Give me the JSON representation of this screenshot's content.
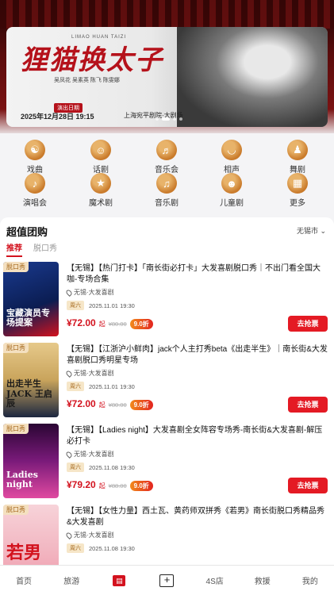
{
  "banner": {
    "title": "狸猫换太子",
    "title_en": "LIMAO HUAN TAIZI",
    "cast": "吴凤花 吴素英 陈飞 陈雯娜",
    "tag": "演出日期",
    "date": "2025年12月28日 19:15",
    "venue": "上海宛平剧院·大剧场"
  },
  "categories": [
    {
      "label": "戏曲",
      "icon": "opera-mask-icon"
    },
    {
      "label": "话剧",
      "icon": "drama-mask-icon"
    },
    {
      "label": "音乐会",
      "icon": "microphone-icon"
    },
    {
      "label": "相声",
      "icon": "lips-icon"
    },
    {
      "label": "舞剧",
      "icon": "dancer-icon"
    },
    {
      "label": "演唱会",
      "icon": "guitar-icon"
    },
    {
      "label": "魔术剧",
      "icon": "star-icon"
    },
    {
      "label": "音乐剧",
      "icon": "music-note-icon"
    },
    {
      "label": "儿童剧",
      "icon": "toy-icon"
    },
    {
      "label": "更多",
      "icon": "grid-icon"
    }
  ],
  "section": {
    "title": "超值团购",
    "city": "无锡市 ⌄",
    "tabs": [
      "推荐",
      "脱口秀"
    ]
  },
  "items": [
    {
      "tag": "脱口秀",
      "poster_text": "宝藏演员专场提案",
      "title": "【无锡】【热门打卡】「南长街必打卡」大发喜剧脱口秀｜不出门看全国大咖-专场合集",
      "venue": "无锡·大发喜剧",
      "day": "周六",
      "date": "2025.11.01 19:30",
      "price": "¥72.00",
      "qi": "起",
      "orig": "¥80.00",
      "discount": "9.0折",
      "buy": "去抢票"
    },
    {
      "tag": "脱口秀",
      "poster_text": "出走半生 JACK 王启辰",
      "title": "【无锡】【江浙沪小鲜肉】jack个人主打秀beta《出走半生》｜南长街&大发喜剧脱口秀明星专场",
      "venue": "无锡·大发喜剧",
      "day": "周六",
      "date": "2025.11.01 19:30",
      "price": "¥72.00",
      "qi": "起",
      "orig": "¥80.00",
      "discount": "9.0折",
      "buy": "去抢票"
    },
    {
      "tag": "脱口秀",
      "poster_text": "Ladies night",
      "title": "【无锡】【Ladies night】大发喜剧全女阵容专场秀-南长街&大发喜剧-解压必打卡",
      "venue": "无锡·大发喜剧",
      "day": "周六",
      "date": "2025.11.08 19:30",
      "price": "¥79.20",
      "qi": "起",
      "orig": "¥88.00",
      "discount": "9.0折",
      "buy": "去抢票"
    },
    {
      "tag": "脱口秀",
      "poster_text": "若男",
      "title": "【无锡】【女性力量】西土瓦、黄药师双拼秀《若男》南长街脱口秀精品秀&大发喜剧",
      "venue": "无锡·大发喜剧",
      "day": "周六",
      "date": "2025.11.08 19:30",
      "price": "",
      "qi": "",
      "orig": "",
      "discount": "",
      "buy": ""
    }
  ],
  "nav": [
    "首页",
    "旅游",
    "",
    "",
    "4S店",
    "救援",
    "我的"
  ],
  "colors": {
    "accent": "#d3121e",
    "tag_bg": "#f4e0c0",
    "tag_fg": "#a66a1f"
  }
}
